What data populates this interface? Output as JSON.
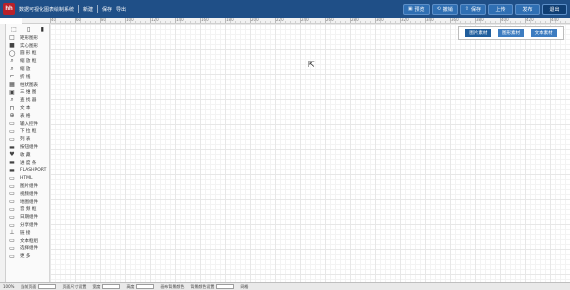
{
  "app": {
    "logo_text": "hh",
    "title": "数据可视化图表绘制系统",
    "menu": [
      "新建",
      "保存",
      "导出"
    ]
  },
  "toolbar": {
    "buttons": [
      {
        "icon": "▣",
        "label": "预览"
      },
      {
        "icon": "⟲",
        "label": "撤销"
      },
      {
        "icon": "⇧",
        "label": "保存"
      },
      {
        "icon": "",
        "label": "上传"
      },
      {
        "icon": "",
        "label": "发布"
      },
      {
        "icon": "",
        "label": "退出"
      }
    ]
  },
  "ruler": {
    "labels": [
      "40",
      "60",
      "80",
      "100",
      "120",
      "140",
      "160",
      "180",
      "200",
      "220",
      "240",
      "260",
      "280",
      "300",
      "320",
      "340",
      "360",
      "380",
      "400",
      "420",
      "440",
      "460",
      "480",
      "500"
    ]
  },
  "sidebar": {
    "top_icons": [
      "⬚",
      "▯",
      "▮"
    ],
    "tools": [
      {
        "icon": "□",
        "label": "矩形图形"
      },
      {
        "icon": "■",
        "label": "实心图形"
      },
      {
        "icon": "◯",
        "label": "圆 形 框"
      },
      {
        "icon": "⌕",
        "label": "缩 放 框"
      },
      {
        "icon": "⌕",
        "label": "缩     放"
      },
      {
        "icon": "⌐",
        "label": "折     线"
      },
      {
        "icon": "▦",
        "label": "柱状图表"
      },
      {
        "icon": "▣",
        "label": "三 维 图"
      },
      {
        "icon": "⌕",
        "label": "查 找 器"
      },
      {
        "icon": "⊓",
        "label": "文     本"
      },
      {
        "icon": "⊕",
        "label": "表     格"
      },
      {
        "icon": "▭",
        "label": "输入控件"
      },
      {
        "icon": "▭",
        "label": "下 拉 框"
      },
      {
        "icon": "▭",
        "label": "列     表"
      },
      {
        "icon": "▬",
        "label": "按钮组件"
      },
      {
        "icon": "♥",
        "label": "收     藏"
      },
      {
        "icon": "▬",
        "label": "进 度 条"
      },
      {
        "icon": "▬",
        "label": "FLASHPORT"
      },
      {
        "icon": "▭",
        "label": "HTML"
      },
      {
        "icon": "▭",
        "label": "图片组件"
      },
      {
        "icon": "▭",
        "label": "视频组件"
      },
      {
        "icon": "▭",
        "label": "地图组件"
      },
      {
        "icon": "▭",
        "label": "音 频 框"
      },
      {
        "icon": "▭",
        "label": "日期组件"
      },
      {
        "icon": "▭",
        "label": "分享组件"
      },
      {
        "icon": "⊥",
        "label": "链     接"
      },
      {
        "icon": "▭",
        "label": "文本框组"
      },
      {
        "icon": "▭",
        "label": "选择组件"
      },
      {
        "icon": "▭",
        "label": "更     多"
      }
    ]
  },
  "float_panel": {
    "buttons": [
      "图片素材",
      "图形素材",
      "文本素材"
    ]
  },
  "statusbar": {
    "items": [
      "100%",
      "当前页面",
      "页面尺寸设置",
      "宽度",
      "高度",
      "画布背景颜色",
      "背景颜色设置",
      "网格"
    ]
  }
}
